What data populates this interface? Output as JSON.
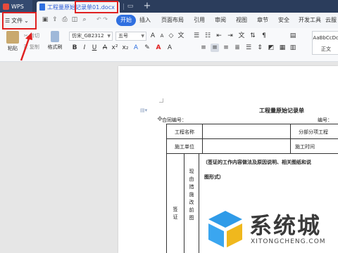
{
  "titlebar": {
    "app_tab": "WPS",
    "doc_tab": "工程量原始记录单01.docx",
    "add_tab": "+"
  },
  "menubar": {
    "file_menu": "文件",
    "items": [
      "开始",
      "插入",
      "页面布局",
      "引用",
      "审阅",
      "视图",
      "章节",
      "安全",
      "开发工具",
      "云服"
    ]
  },
  "ribbon": {
    "paste": "粘贴",
    "cut": "剪切",
    "copy": "复制",
    "format_painter": "格式刷",
    "font_name": "仿宋_GB2312",
    "font_size": "五号",
    "style_preview": "AaBbCcDd",
    "style_name": "正文"
  },
  "document": {
    "title": "工程量原始记录单",
    "contract_no_label": "合同编号：",
    "id_no_label": "编号：",
    "table": {
      "project_name_label": "工程名称",
      "sub_project_label": "分部分项工程",
      "contractor_label": "施工单位",
      "construction_time_label": "施工时间",
      "content_line1": "（签证的工作内容做法及原因说明、相关图纸和说",
      "content_line2": "图形式）",
      "vertical_label_right": "现由措施改前图",
      "vertical_label_left": "签证"
    }
  },
  "watermark": {
    "text": "系统城",
    "url": "XITONGCHENG.COM"
  },
  "colors": {
    "titlebar_bg": "#2b3d5c",
    "accent": "#2f6fe0",
    "annotation": "#e02020"
  }
}
